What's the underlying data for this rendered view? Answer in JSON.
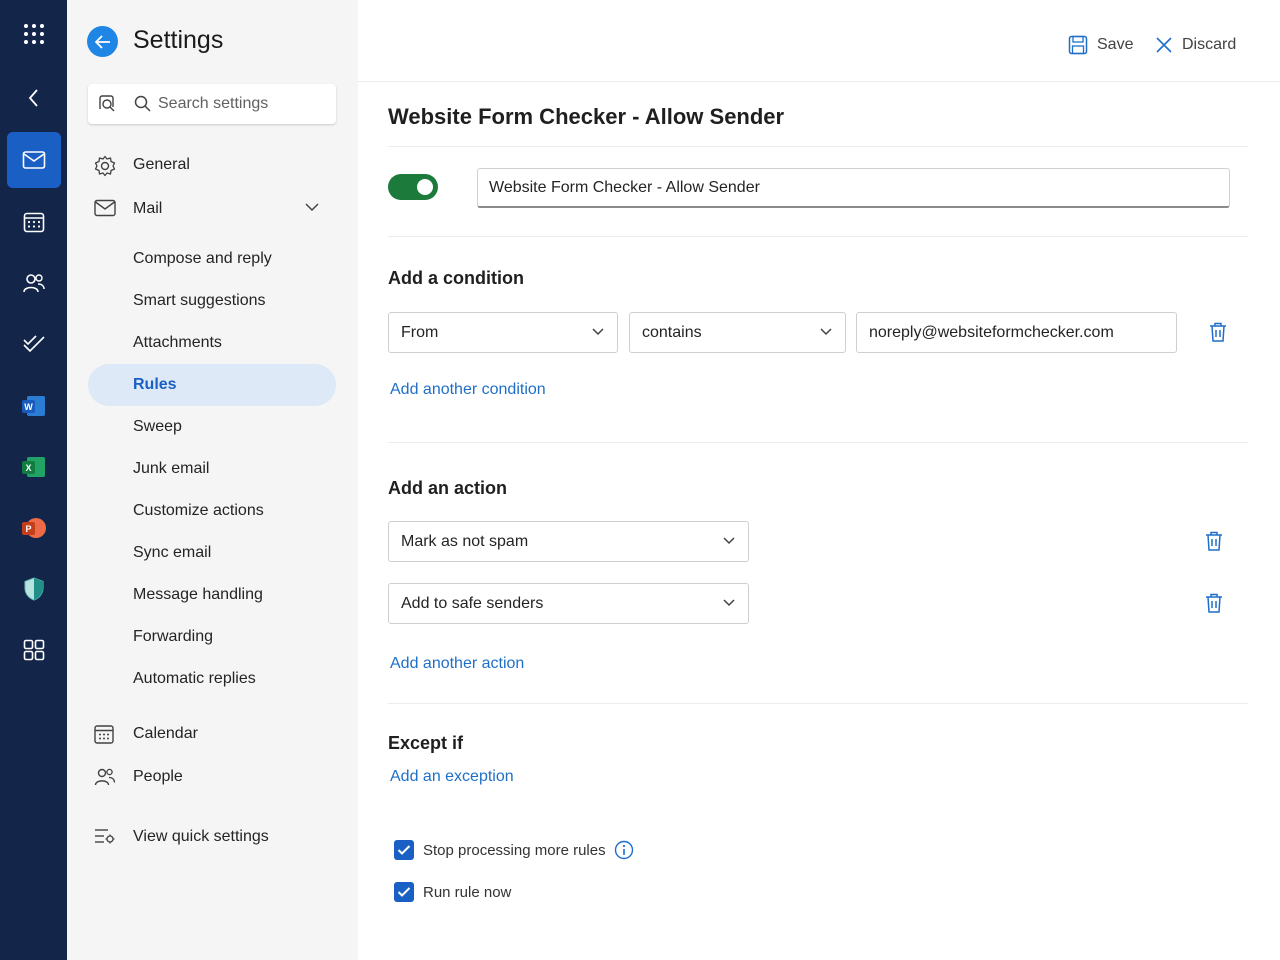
{
  "nav": {
    "title": "Settings",
    "search_placeholder": "Search settings",
    "general": "General",
    "mail": "Mail",
    "mail_items": [
      "Compose and reply",
      "Smart suggestions",
      "Attachments",
      "Rules",
      "Sweep",
      "Junk email",
      "Customize actions",
      "Sync email",
      "Message handling",
      "Forwarding",
      "Automatic replies"
    ],
    "selected_item": "Rules",
    "calendar": "Calendar",
    "people": "People",
    "quick_settings": "View quick settings"
  },
  "rail": {
    "icons": [
      "app-launcher-icon",
      "collapse-icon",
      "mail-icon",
      "calendar-icon",
      "people-icon",
      "todo-icon",
      "word-icon",
      "excel-icon",
      "powerpoint-icon",
      "defender-icon",
      "more-apps-icon"
    ],
    "active": "mail-icon"
  },
  "toolbar": {
    "save_label": "Save",
    "discard_label": "Discard"
  },
  "rule": {
    "title": "Website Form Checker - Allow Sender",
    "name_value": "Website Form Checker - Allow Sender",
    "enabled": true,
    "condition_heading": "Add a condition",
    "condition_field": "From",
    "condition_operator": "contains",
    "condition_value": "noreply@websiteformchecker.com",
    "add_condition_link": "Add another condition",
    "action_heading": "Add an action",
    "actions": [
      "Mark as not spam",
      "Add to safe senders"
    ],
    "add_action_link": "Add another action",
    "except_heading": "Except if",
    "add_exception_link": "Add an exception",
    "stop_processing_label": "Stop processing more rules",
    "stop_processing_checked": true,
    "run_now_label": "Run rule now",
    "run_now_checked": true
  },
  "colors": {
    "rail_bg": "#13264a",
    "rail_active": "#1a5fc4",
    "accent": "#1f6fc9",
    "toggle_on": "#1c7a3b",
    "nav_selected_bg": "#dde9f6"
  }
}
